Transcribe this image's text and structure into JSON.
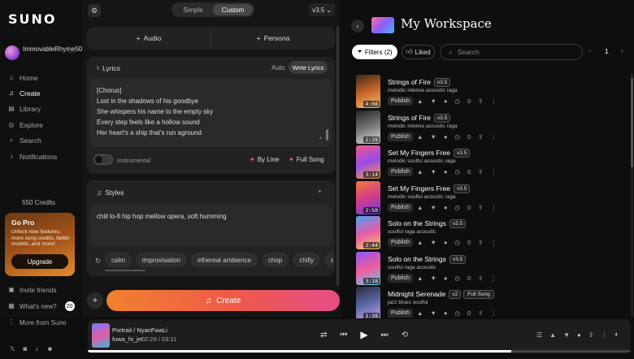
{
  "sidebar": {
    "logo": "SUNO",
    "user_name": "ImmovableRhyme507",
    "nav": [
      {
        "label": "Home",
        "icon": "home-icon",
        "glyph": "⌂"
      },
      {
        "label": "Create",
        "icon": "music-note-icon",
        "glyph": "♫",
        "active": true
      },
      {
        "label": "Library",
        "icon": "library-icon",
        "glyph": "▤"
      },
      {
        "label": "Explore",
        "icon": "compass-icon",
        "glyph": "◎"
      },
      {
        "label": "Search",
        "icon": "search-icon",
        "glyph": "⌕"
      },
      {
        "label": "Notifications",
        "icon": "bell-icon",
        "glyph": "♪"
      }
    ],
    "credits": "550 Credits",
    "gopro": {
      "title": "Go Pro",
      "desc": "Unlock new features, more song credits, better models, and more!",
      "button": "Upgrade"
    },
    "bottom": {
      "invite": "Invite friends",
      "whatsnew": "What's new?",
      "whatsnew_count": "20",
      "more": "More from Suno"
    },
    "socials": [
      "x-icon",
      "instagram-icon",
      "tiktok-icon",
      "discord-icon"
    ]
  },
  "create": {
    "mode": {
      "simple": "Simple",
      "custom": "Custom",
      "active": "Custom"
    },
    "version": "v3.5",
    "audio_label": "Audio",
    "persona_label": "Persona",
    "lyrics": {
      "title": "Lyrics",
      "auto_label": "Auto",
      "write_label": "Write Lyrics",
      "lines": [
        "[Chorus]",
        "Lost in the shadows of his goodbye",
        "She whispers his name to the empty sky",
        "Every step feels like a hollow sound",
        "Her heart's a ship that's run aground"
      ]
    },
    "instrumental_label": "Instrumental",
    "byline_label": "By Line",
    "fullsong_label": "Full Song",
    "styles": {
      "title": "Styles",
      "value": "chill  lo-fi  hip hop  mellow opera, soft humming",
      "chips": [
        "calm",
        "improvisation",
        "ethereal ambience",
        "chop",
        "chilly",
        "sound"
      ]
    },
    "create_label": "Create"
  },
  "workspace": {
    "title": "My Workspace",
    "filters_label": "Filters (2)",
    "liked_label": "Liked",
    "search_placeholder": "Search",
    "page": "1",
    "songs": [
      {
        "title": "Strings of Fire",
        "version": "v3.5",
        "style": "melodic intense acoustic raga",
        "duration": "4:08",
        "thumb": "linear-gradient(160deg,#3b2a1a,#c8642a,#f2c26b)",
        "dot": false
      },
      {
        "title": "Strings of Fire",
        "version": "v3.5",
        "style": "melodic intense acoustic raga",
        "duration": "2:39",
        "thumb": "linear-gradient(160deg,#222,#777,#ddd)",
        "dot": false
      },
      {
        "title": "Set My Fingers Free",
        "version": "v3.5",
        "style": "melodic soulful acoustic raga",
        "duration": "3:14",
        "thumb": "linear-gradient(160deg,#f25a8c,#9a4be8,#f2a23c)",
        "dot": false
      },
      {
        "title": "Set My Fingers Free",
        "version": "v3.5",
        "style": "melodic soulful acoustic raga",
        "duration": "2:50",
        "thumb": "linear-gradient(160deg,#f27a3c,#d23c8a,#6a3ce8)",
        "dot": true
      },
      {
        "title": "Solo on the Strings",
        "version": "v3.5",
        "style": "soulful raga acoustic",
        "duration": "2:44",
        "thumb": "linear-gradient(160deg,#4aa3f2,#e85aa8,#f2d25a)",
        "dot": true
      },
      {
        "title": "Solo on the Strings",
        "version": "v3.5",
        "style": "soulful raga acoustic",
        "duration": "3:18",
        "thumb": "linear-gradient(160deg,#8a5af2,#f25a9c,#5ad2f2)",
        "dot": true
      },
      {
        "title": "Midnight Serenade",
        "version": "v2",
        "extra": "Full Song",
        "style": "jazz blues soulful",
        "duration": "1:38",
        "thumb": "linear-gradient(160deg,#2a2a3a,#5a6aa8,#c8a0e8)",
        "dot": false
      }
    ],
    "publish_label": "Publish",
    "play_count": "0"
  },
  "player": {
    "title": "Portrait / NyanFwaLi",
    "artist": "fuwa_hi_jet",
    "time": "02:29 / 03:11",
    "progress": 0.78
  }
}
